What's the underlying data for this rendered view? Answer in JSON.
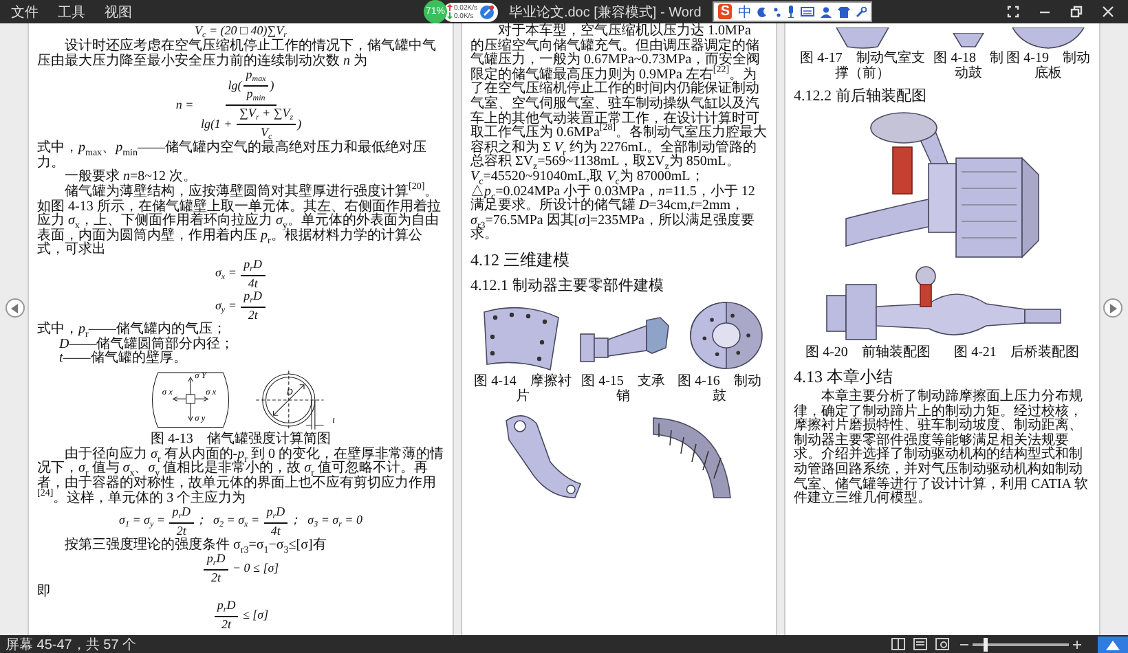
{
  "window": {
    "menu": [
      "文件",
      "工具",
      "视图"
    ],
    "title": "毕业论文.doc [兼容模式] - Word"
  },
  "net_monitor": {
    "percent": "71%",
    "upload": "0.02K/s",
    "download": "0.0K/s"
  },
  "ime_toolbar": {
    "logo": "S",
    "mode": "中"
  },
  "pages": [
    {
      "blocks": [
        {
          "kind": "equation",
          "math": [
            "V$_{c}$ = (20 □ 40)∑V$_{r}$"
          ]
        },
        {
          "kind": "para",
          "text": "设计时还应考虑在空气压缩机停止工作的情况下，储气罐中气压由最大压力降至最小安全压力前的连续制动次数 *n* 为"
        },
        {
          "kind": "equation",
          "math": [
            "n = ",
            {
              "num": [
                "lg(",
                {
                  "num": "p$_{max}$",
                  "den": "p$_{min}$"
                },
                ")"
              ],
              "den": [
                "lg(1 + ",
                {
                  "num": "∑V$_{r}$ + ∑V$_{z}$",
                  "den": "V$_{c}$"
                },
                ")"
              ]
            }
          ]
        },
        {
          "kind": "note",
          "text": "式中，*p*$_{max}$、*p*$_{min}$——储气罐内空气的最高绝对压力和最低绝对压力。"
        },
        {
          "kind": "para",
          "text": "一般要求 *n*=8~12 次。"
        },
        {
          "kind": "para",
          "text": "储气罐为薄壁结构，应按薄壁圆筒对其壁厚进行强度计算$^{[20]}$。如图 4-13 所示，在储气罐壁上取一单元体。其左、右侧面作用着拉应力 *σ*$_{x}$，上、下侧面作用着环向拉应力 *σ*$_{y}$。单元体的外表面为自由表面，内面为圆筒内壁，作用着内压 *p*$_{r}$。根据材料力学的计算公式，可求出"
        },
        {
          "kind": "equation",
          "math": [
            "σ$_{x}$ = ",
            {
              "num": "p$_{r}$D",
              "den": "4t"
            }
          ]
        },
        {
          "kind": "equation",
          "math": [
            "σ$_{y}$ = ",
            {
              "num": "p$_{r}$D",
              "den": "2t"
            }
          ]
        },
        {
          "kind": "note",
          "text": "式中，*p*$_{r}$——储气罐内的气压；"
        },
        {
          "kind": "note_item",
          "text": "*D*——储气罐圆筒部分内径；"
        },
        {
          "kind": "note_item",
          "text": "*t*——储气罐的壁厚。"
        },
        {
          "kind": "stress_diagram",
          "labels": [
            "σ Y",
            "σ x",
            "σ x",
            "σ y",
            "D",
            "t"
          ],
          "caption": "图 4-13　储气罐强度计算简图"
        },
        {
          "kind": "para",
          "text": "由于径向应力 *σ*$_{r}$ 有从内面的-*p*$_{r}$ 到 0 的变化，在壁厚非常薄的情况下，*σ*$_{r}$ 值与 *σ*$_{x}$、*σ*$_{y}$ 值相比是非常小的，故 *σ*$_{r}$ 值可忽略不计。再者，由于容器的对称性，故单元体的界面上也不应有剪切应力作用$^{[24]}$。这样，单元体的 3 个主应力为"
        },
        {
          "kind": "equation",
          "math": [
            "σ$_{1}$ = σ$_{y}$ = ",
            {
              "num": "p$_{r}$D",
              "den": "2t"
            },
            "；  σ$_{2}$ = σ$_{x}$ = ",
            {
              "num": "p$_{r}$D",
              "den": "4t"
            },
            "；  σ$_{3}$ = σ$_{r}$ = 0"
          ]
        },
        {
          "kind": "para",
          "text": "按第三强度理论的强度条件 σ$_{r3}$=σ$_{1}$−σ$_{3}$≤[σ]有"
        },
        {
          "kind": "equation",
          "math": [
            {
              "num": "p$_{r}$D",
              "den": "2t"
            },
            " − 0 ≤ [σ]"
          ]
        },
        {
          "kind": "note",
          "text": "即"
        },
        {
          "kind": "equation",
          "math": [
            {
              "num": "p$_{r}$D",
              "den": "2t"
            },
            " ≤ [σ]"
          ]
        }
      ]
    },
    {
      "blocks": [
        {
          "kind": "para",
          "text": "对于本车型，空气压缩机以压力达 1.0MPa 的压缩空气向储气罐充气。但由调压器调定的储气罐压力，一般为 0.67MPa~0.73MPa，而安全阀限定的储气罐最高压力则为 0.9MPa 左右$^{[22]}$。为了在空气压缩机停止工作的时间内仍能保证制动气室、空气伺服气室、驻车制动操纵气缸以及汽车上的其他气动装置正常工作，在设计计算时可取工作气压为 0.6MPa$^{[28]}$。各制动气室压力腔最大容积之和为 Σ *V*$_{r}$ 约为 2276mL。全部制动管路的总容积 ΣV$_{z}$=569~1138mL，取ΣV$_{z}$为 850mL。*V*$_{c}$=45520~91040mL,取 *V*$_{c}$为 87000mL；△*p*$_{c}$=0.024MPa 小于 0.03MPa，*n*=11.5，小于 12 满足要求。所设计的储气罐 *D*=34cm,*t*=2mm，*σ*$_{r3}$=76.5MPa 因其[*σ*]=235MPa，所以满足强度要求。"
        },
        {
          "kind": "heading",
          "text": "4.12 三维建模"
        },
        {
          "kind": "subheading",
          "text": "4.12.1 制动器主要零部件建模"
        },
        {
          "kind": "figure_row",
          "figures": [
            {
              "kind": "plate",
              "caption": "图 4-14　摩擦衬片"
            },
            {
              "kind": "pin",
              "caption": "图 4-15　支承销"
            },
            {
              "kind": "drum",
              "caption": "图 4-16　制动鼓"
            }
          ]
        },
        {
          "kind": "figure_row",
          "figures": [
            {
              "kind": "bracket"
            },
            {
              "kind": "shoe"
            }
          ]
        }
      ]
    },
    {
      "blocks": [
        {
          "kind": "figure_row",
          "figures": [
            {
              "kind": "support_cut",
              "caption": "图 4-17　制动气室支撑（前）"
            },
            {
              "kind": "cam_cut",
              "caption": "图 4-18　制动鼓"
            },
            {
              "kind": "base_cut",
              "caption": "图 4-19　制动底板"
            }
          ]
        },
        {
          "kind": "subheading",
          "text": "4.12.2 前后轴装配图"
        },
        {
          "kind": "figure_row",
          "figures": [
            {
              "kind": "front_axle"
            }
          ]
        },
        {
          "kind": "figure_row",
          "figures": [
            {
              "kind": "rear_axle"
            }
          ]
        },
        {
          "kind": "captions",
          "items": [
            "图 4-20　前轴装配图",
            "图 4-21　后桥装配图"
          ]
        },
        {
          "kind": "heading",
          "text": "4.13 本章小结"
        },
        {
          "kind": "para",
          "text": "本章主要分析了制动蹄摩擦面上压力分布规律，确定了制动蹄片上的制动力矩。经过校核，摩擦衬片磨损特性、驻车制动坡度、制动距离、制动器主要零部件强度等能够满足相关法规要求。介绍并选择了制动驱动机构的结构型式和制动管路回路系统，并对气压制动驱动机构如制动气室、储气罐等进行了设计计算，利用 CATIA 软件建立三维几何模型。"
        }
      ]
    }
  ],
  "status_bar": {
    "text": "屏幕 45-47，共 57 个",
    "zoom": {
      "level": 0.12
    }
  }
}
